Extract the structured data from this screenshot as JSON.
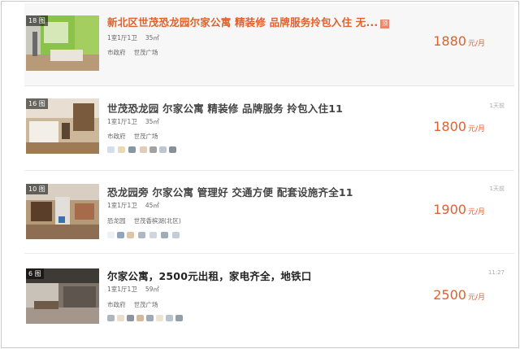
{
  "listings": [
    {
      "photo_count": "18 图",
      "title": "新北区世茂恐龙园尔家公寓 精装修 品牌服务拎包入住 无...",
      "tag": "顶",
      "layout": "1室1厅1卫",
      "area": "35㎡",
      "district": "市政府",
      "community": "世茂广场",
      "price": "1880",
      "price_unit": "元/月",
      "time": ""
    },
    {
      "photo_count": "16 图",
      "title": "世茂恐龙园 尔家公寓 精装修 品牌服务 拎包入住11",
      "layout": "1室1厅1卫",
      "area": "35㎡",
      "district": "市政府",
      "community": "世茂广场",
      "price": "1800",
      "price_unit": "元/月",
      "time": "1天前"
    },
    {
      "photo_count": "10 图",
      "title": "恐龙园旁 尔家公寓 管理好 交通方便 配套设施齐全11",
      "layout": "1室1厅1卫",
      "area": "45㎡",
      "district": "恐龙园",
      "community": "世茂香槟湖(北区)",
      "price": "1900",
      "price_unit": "元/月",
      "time": "1天前"
    },
    {
      "photo_count": "6 图",
      "title": "尔家公寓，2500元出租，家电齐全，地铁口",
      "layout": "1室1厅1卫",
      "area": "59㎡",
      "district": "市政府",
      "community": "世茂广场",
      "price": "2500",
      "price_unit": "元/月",
      "time": "11:27"
    }
  ],
  "colors": {
    "accent": "#e0612c",
    "title_gray": "#444444",
    "highlight_bg": "#f7f7f7"
  }
}
